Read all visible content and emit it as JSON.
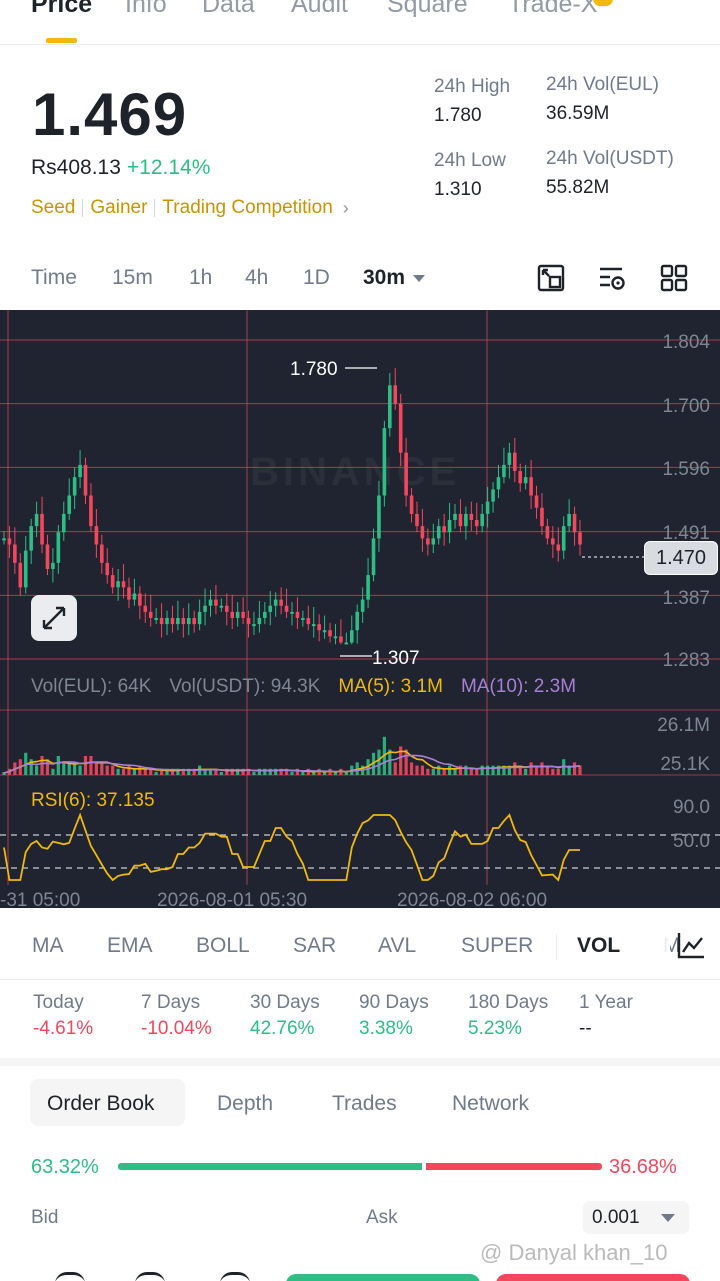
{
  "top_tabs": [
    "Price",
    "Info",
    "Data",
    "Audit",
    "Square",
    "Trade-X"
  ],
  "price": {
    "last": "1.469",
    "fiat": "Rs408.13",
    "change_pct": "+12.14%",
    "tags": [
      "Seed",
      "Gainer",
      "Trading Competition"
    ]
  },
  "stats": {
    "high_label": "24h High",
    "high_value": "1.780",
    "low_label": "24h Low",
    "low_value": "1.310",
    "vol_base_label": "24h Vol(EUL)",
    "vol_base_value": "36.59M",
    "vol_quote_label": "24h Vol(USDT)",
    "vol_quote_value": "55.82M"
  },
  "intervals": [
    "Time",
    "15m",
    "1h",
    "4h",
    "1D",
    "30m"
  ],
  "chart": {
    "price_axis": [
      "1.804",
      "1.700",
      "1.596",
      "1.491",
      "1.387",
      "1.283"
    ],
    "high_marker": "1.780",
    "low_marker": "1.307",
    "last_price": "1.470",
    "watermark": "BINANCE",
    "vol_legend": {
      "base": "Vol(EUL): 64K",
      "quote": "Vol(USDT): 94.3K",
      "ma5": "MA(5): 3.1M",
      "ma10": "MA(10): 2.3M"
    },
    "vol_axis": [
      "26.1M",
      "25.1K"
    ],
    "rsi_legend": "RSI(6): 37.135",
    "rsi_axis": [
      "90.0",
      "50.0"
    ],
    "time_axis": [
      "-31 05:00",
      "2026-08-01 05:30",
      "2026-08-02 06:00"
    ],
    "colors": {
      "up": "#2ebd85",
      "down": "#f6465d",
      "ma5": "#f0b90b",
      "ma10": "#a97fd6",
      "bg": "#1f2430"
    }
  },
  "chart_data": {
    "type": "candlestick",
    "title": "",
    "ylim": [
      1.283,
      1.804
    ],
    "yticks": [
      1.804,
      1.7,
      1.596,
      1.491,
      1.387,
      1.283
    ],
    "high": 1.78,
    "low": 1.307,
    "last": 1.47,
    "close_series": [
      1.48,
      1.47,
      1.44,
      1.4,
      1.46,
      1.5,
      1.52,
      1.47,
      1.43,
      1.44,
      1.49,
      1.52,
      1.55,
      1.58,
      1.6,
      1.55,
      1.5,
      1.47,
      1.44,
      1.42,
      1.4,
      1.41,
      1.4,
      1.38,
      1.39,
      1.37,
      1.36,
      1.35,
      1.35,
      1.34,
      1.35,
      1.34,
      1.35,
      1.34,
      1.35,
      1.34,
      1.36,
      1.37,
      1.38,
      1.37,
      1.37,
      1.36,
      1.35,
      1.36,
      1.35,
      1.34,
      1.34,
      1.35,
      1.36,
      1.37,
      1.38,
      1.37,
      1.36,
      1.36,
      1.35,
      1.35,
      1.34,
      1.34,
      1.33,
      1.33,
      1.32,
      1.32,
      1.31,
      1.31,
      1.33,
      1.36,
      1.38,
      1.42,
      1.48,
      1.55,
      1.66,
      1.73,
      1.7,
      1.62,
      1.55,
      1.52,
      1.5,
      1.48,
      1.47,
      1.48,
      1.5,
      1.49,
      1.51,
      1.52,
      1.5,
      1.52,
      1.51,
      1.5,
      1.52,
      1.54,
      1.56,
      1.58,
      1.6,
      1.62,
      1.59,
      1.57,
      1.58,
      1.55,
      1.53,
      1.5,
      1.48,
      1.47,
      1.46,
      1.5,
      1.52,
      1.49,
      1.47
    ],
    "volume_axis": [
      "26.1M",
      "25.1K"
    ],
    "rsi": {
      "period": 6,
      "value": 37.135,
      "levels": [
        90.0,
        50.0
      ]
    },
    "x_labels": [
      "-31 05:00",
      "2026-08-01 05:30",
      "2026-08-02 06:00"
    ]
  },
  "indicators": [
    "MA",
    "EMA",
    "BOLL",
    "SAR",
    "AVL",
    "SUPER",
    "VOL",
    "M"
  ],
  "performance": [
    {
      "label": "Today",
      "value": "-4.61%",
      "tone": "neg"
    },
    {
      "label": "7 Days",
      "value": "-10.04%",
      "tone": "neg"
    },
    {
      "label": "30 Days",
      "value": "42.76%",
      "tone": "pos"
    },
    {
      "label": "90 Days",
      "value": "3.38%",
      "tone": "pos"
    },
    {
      "label": "180 Days",
      "value": "5.23%",
      "tone": "pos"
    },
    {
      "label": "1 Year",
      "value": "--",
      "tone": "neu"
    }
  ],
  "order_book": {
    "tabs": [
      "Order Book",
      "Depth",
      "Trades",
      "Network"
    ],
    "bid_pct": "63.32%",
    "ask_pct": "36.68%",
    "bid_ratio": 0.6332,
    "bid_label": "Bid",
    "ask_label": "Ask",
    "precision": "0.001"
  },
  "credit": "@ Danyal khan_10"
}
